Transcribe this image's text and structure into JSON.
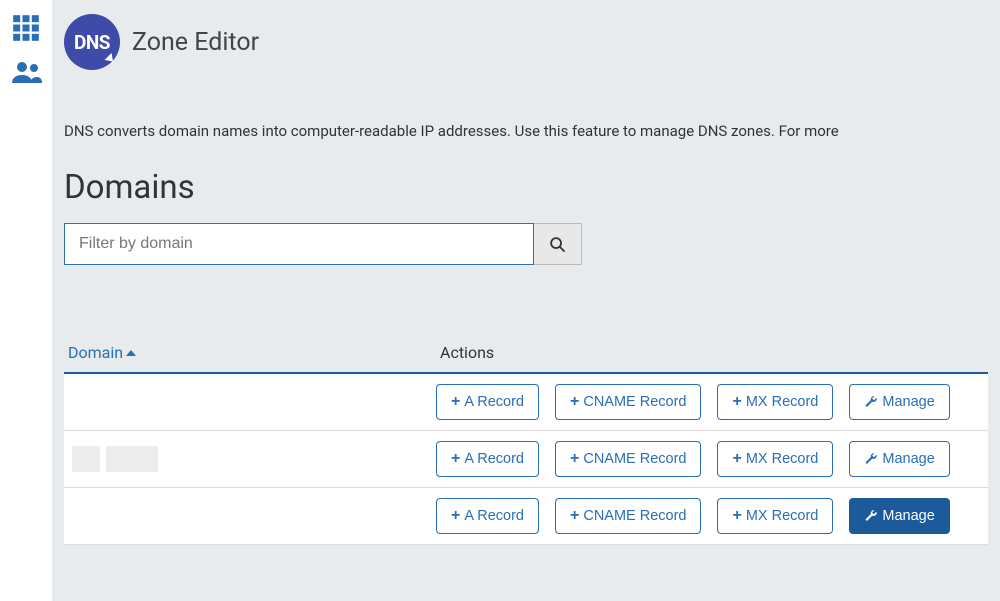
{
  "header": {
    "icon_text": "DNS",
    "title": "Zone Editor"
  },
  "intro_text": "DNS converts domain names into computer-readable IP addresses. Use this feature to manage DNS zones. For more",
  "section_title": "Domains",
  "filter": {
    "placeholder": "Filter by domain"
  },
  "table": {
    "columns": {
      "domain": "Domain",
      "actions": "Actions"
    },
    "buttons": {
      "a_record": "A Record",
      "cname_record": "CNAME Record",
      "mx_record": "MX Record",
      "manage": "Manage"
    },
    "rows": [
      {
        "manage_active": false
      },
      {
        "manage_active": false
      },
      {
        "manage_active": true
      }
    ]
  },
  "colors": {
    "primary": "#2a6eb5",
    "primary_dark": "#1c5a9c"
  }
}
